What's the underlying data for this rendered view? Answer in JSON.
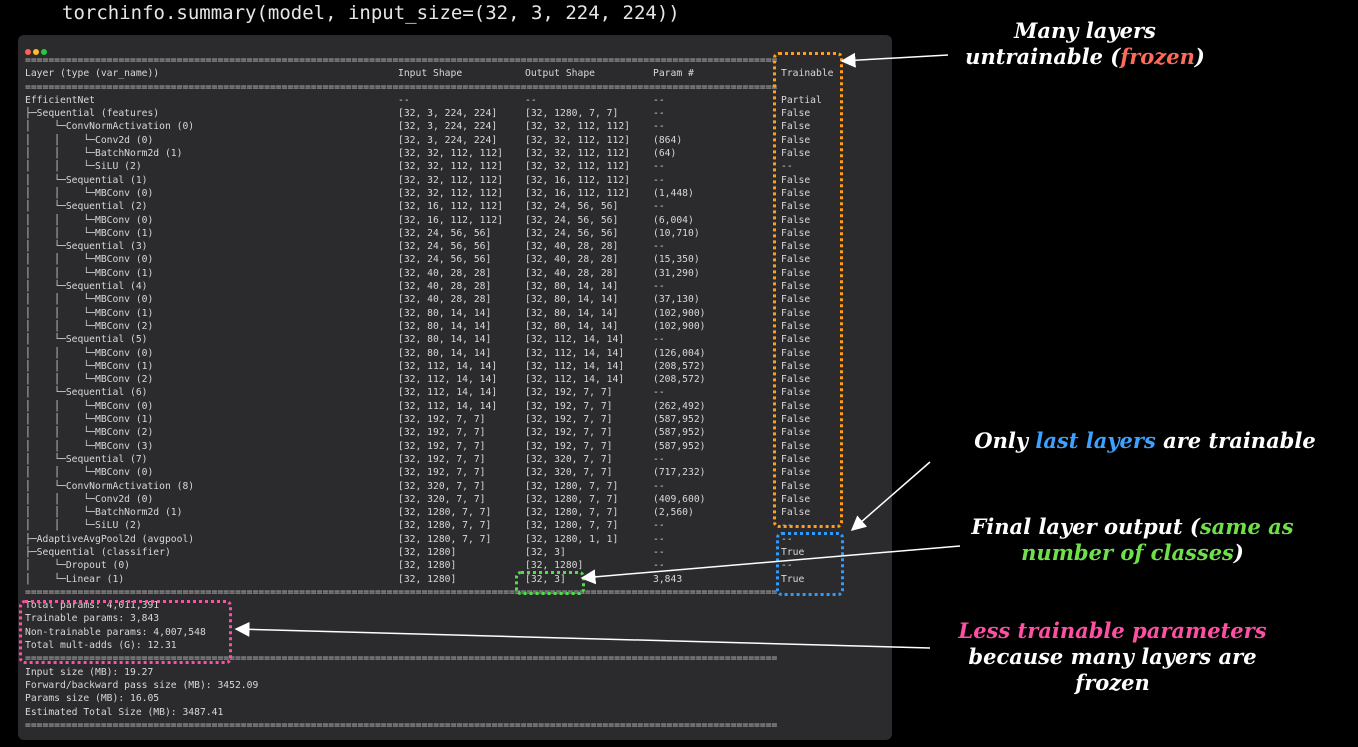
{
  "code_line": "torchinfo.summary(model, input_size=(32, 3, 224, 224))",
  "window": {
    "dots": [
      "#ff5f57",
      "#febc2e",
      "#28c840"
    ]
  },
  "separator": "=================================================================================================================================",
  "headers": [
    "Layer (type (var_name))",
    "Input Shape",
    "Output Shape",
    "Param #",
    "Trainable"
  ],
  "rows": [
    [
      "EfficientNet",
      "--",
      "--",
      "--",
      "Partial"
    ],
    [
      "├─Sequential (features)",
      "[32, 3, 224, 224]",
      "[32, 1280, 7, 7]",
      "--",
      "False"
    ],
    [
      "│    └─ConvNormActivation (0)",
      "[32, 3, 224, 224]",
      "[32, 32, 112, 112]",
      "--",
      "False"
    ],
    [
      "│    │    └─Conv2d (0)",
      "[32, 3, 224, 224]",
      "[32, 32, 112, 112]",
      "(864)",
      "False"
    ],
    [
      "│    │    └─BatchNorm2d (1)",
      "[32, 32, 112, 112]",
      "[32, 32, 112, 112]",
      "(64)",
      "False"
    ],
    [
      "│    │    └─SiLU (2)",
      "[32, 32, 112, 112]",
      "[32, 32, 112, 112]",
      "--",
      "--"
    ],
    [
      "│    └─Sequential (1)",
      "[32, 32, 112, 112]",
      "[32, 16, 112, 112]",
      "--",
      "False"
    ],
    [
      "│    │    └─MBConv (0)",
      "[32, 32, 112, 112]",
      "[32, 16, 112, 112]",
      "(1,448)",
      "False"
    ],
    [
      "│    └─Sequential (2)",
      "[32, 16, 112, 112]",
      "[32, 24, 56, 56]",
      "--",
      "False"
    ],
    [
      "│    │    └─MBConv (0)",
      "[32, 16, 112, 112]",
      "[32, 24, 56, 56]",
      "(6,004)",
      "False"
    ],
    [
      "│    │    └─MBConv (1)",
      "[32, 24, 56, 56]",
      "[32, 24, 56, 56]",
      "(10,710)",
      "False"
    ],
    [
      "│    └─Sequential (3)",
      "[32, 24, 56, 56]",
      "[32, 40, 28, 28]",
      "--",
      "False"
    ],
    [
      "│    │    └─MBConv (0)",
      "[32, 24, 56, 56]",
      "[32, 40, 28, 28]",
      "(15,350)",
      "False"
    ],
    [
      "│    │    └─MBConv (1)",
      "[32, 40, 28, 28]",
      "[32, 40, 28, 28]",
      "(31,290)",
      "False"
    ],
    [
      "│    └─Sequential (4)",
      "[32, 40, 28, 28]",
      "[32, 80, 14, 14]",
      "--",
      "False"
    ],
    [
      "│    │    └─MBConv (0)",
      "[32, 40, 28, 28]",
      "[32, 80, 14, 14]",
      "(37,130)",
      "False"
    ],
    [
      "│    │    └─MBConv (1)",
      "[32, 80, 14, 14]",
      "[32, 80, 14, 14]",
      "(102,900)",
      "False"
    ],
    [
      "│    │    └─MBConv (2)",
      "[32, 80, 14, 14]",
      "[32, 80, 14, 14]",
      "(102,900)",
      "False"
    ],
    [
      "│    └─Sequential (5)",
      "[32, 80, 14, 14]",
      "[32, 112, 14, 14]",
      "--",
      "False"
    ],
    [
      "│    │    └─MBConv (0)",
      "[32, 80, 14, 14]",
      "[32, 112, 14, 14]",
      "(126,004)",
      "False"
    ],
    [
      "│    │    └─MBConv (1)",
      "[32, 112, 14, 14]",
      "[32, 112, 14, 14]",
      "(208,572)",
      "False"
    ],
    [
      "│    │    └─MBConv (2)",
      "[32, 112, 14, 14]",
      "[32, 112, 14, 14]",
      "(208,572)",
      "False"
    ],
    [
      "│    └─Sequential (6)",
      "[32, 112, 14, 14]",
      "[32, 192, 7, 7]",
      "--",
      "False"
    ],
    [
      "│    │    └─MBConv (0)",
      "[32, 112, 14, 14]",
      "[32, 192, 7, 7]",
      "(262,492)",
      "False"
    ],
    [
      "│    │    └─MBConv (1)",
      "[32, 192, 7, 7]",
      "[32, 192, 7, 7]",
      "(587,952)",
      "False"
    ],
    [
      "│    │    └─MBConv (2)",
      "[32, 192, 7, 7]",
      "[32, 192, 7, 7]",
      "(587,952)",
      "False"
    ],
    [
      "│    │    └─MBConv (3)",
      "[32, 192, 7, 7]",
      "[32, 192, 7, 7]",
      "(587,952)",
      "False"
    ],
    [
      "│    └─Sequential (7)",
      "[32, 192, 7, 7]",
      "[32, 320, 7, 7]",
      "--",
      "False"
    ],
    [
      "│    │    └─MBConv (0)",
      "[32, 192, 7, 7]",
      "[32, 320, 7, 7]",
      "(717,232)",
      "False"
    ],
    [
      "│    └─ConvNormActivation (8)",
      "[32, 320, 7, 7]",
      "[32, 1280, 7, 7]",
      "--",
      "False"
    ],
    [
      "│    │    └─Conv2d (0)",
      "[32, 320, 7, 7]",
      "[32, 1280, 7, 7]",
      "(409,600)",
      "False"
    ],
    [
      "│    │    └─BatchNorm2d (1)",
      "[32, 1280, 7, 7]",
      "[32, 1280, 7, 7]",
      "(2,560)",
      "False"
    ],
    [
      "│    │    └─SiLU (2)",
      "[32, 1280, 7, 7]",
      "[32, 1280, 7, 7]",
      "--",
      "--"
    ],
    [
      "├─AdaptiveAvgPool2d (avgpool)",
      "[32, 1280, 7, 7]",
      "[32, 1280, 1, 1]",
      "--",
      "--"
    ],
    [
      "├─Sequential (classifier)",
      "[32, 1280]",
      "[32, 3]",
      "--",
      "True"
    ],
    [
      "│    └─Dropout (0)",
      "[32, 1280]",
      "[32, 1280]",
      "--",
      "--"
    ],
    [
      "│    └─Linear (1)",
      "[32, 1280]",
      "[32, 3]",
      "3,843",
      "True"
    ]
  ],
  "totals": [
    "Total params: 4,011,391",
    "Trainable params: 3,843",
    "Non-trainable params: 4,007,548",
    "Total mult-adds (G): 12.31"
  ],
  "sizes": [
    "Input size (MB): 19.27",
    "Forward/backward pass size (MB): 3452.09",
    "Params size (MB): 16.05",
    "Estimated Total Size (MB): 3487.41"
  ],
  "annotations": {
    "frozen": {
      "pre": "Many layers",
      "mid": "untrainable (",
      "hl": "frozen",
      "post": ")",
      "hl_color": "#ff6b5b"
    },
    "last": {
      "pre": "Only ",
      "hl": "last layers",
      "post": " are trainable",
      "hl_color": "#3ea0ff"
    },
    "final": {
      "pre": "Final layer output (",
      "hl": "same as",
      "hl2": "number of classes",
      "post": ")",
      "hl_color": "#6fe04c"
    },
    "less": {
      "hl": "Less trainable parameters",
      "post1": "because many layers are",
      "post2": "frozen",
      "hl_color": "#ff4fa3"
    }
  },
  "colors": {
    "orange": "#ff9d1c",
    "blue": "#2f9bff",
    "green": "#4ee04a",
    "pink": "#ff4fa3"
  }
}
